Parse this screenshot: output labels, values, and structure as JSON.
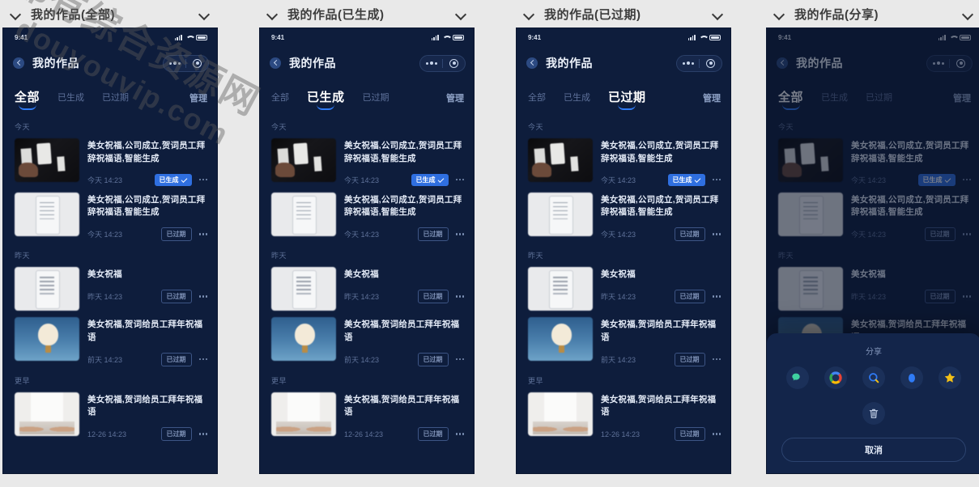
{
  "panels": [
    {
      "caption": "我的作品(全部)",
      "active_tab": 0,
      "shaded": false,
      "sheet": false
    },
    {
      "caption": "我的作品(已生成)",
      "active_tab": 1,
      "shaded": false,
      "sheet": false
    },
    {
      "caption": "我的作品(已过期)",
      "active_tab": 2,
      "shaded": false,
      "sheet": false
    },
    {
      "caption": "我的作品(分享)",
      "active_tab": 0,
      "shaded": true,
      "sheet": true
    }
  ],
  "statusbar": {
    "time": "9:41",
    "signal_icon": "signal-bars-icon",
    "wifi_icon": "wifi-icon",
    "battery_icon": "battery-icon"
  },
  "navbar": {
    "back_icon": "back-arrow-icon",
    "title": "我的作品",
    "capsule_more_icon": "more-dots-icon",
    "capsule_target_icon": "target-circle-icon"
  },
  "tabs": {
    "items": [
      "全部",
      "已生成",
      "已过期"
    ],
    "manage_label": "管理"
  },
  "groups": [
    {
      "label": "今天",
      "items": [
        {
          "title": "美女祝福,公司成立,贺词员工拜辞祝福语,智能生成",
          "time": "今天 14:23",
          "status": "已生成",
          "status_type": "done",
          "thumb": "playing-cards-thumbnail"
        },
        {
          "title": "美女祝福,公司成立,贺词员工拜辞祝福语,智能生成",
          "time": "今天 14:23",
          "status": "已过期",
          "status_type": "expired",
          "thumb": "document-thumbnail"
        }
      ]
    },
    {
      "label": "昨天",
      "items": [
        {
          "title": "美女祝福",
          "time": "昨天 14:23",
          "status": "已过期",
          "status_type": "expired",
          "thumb": "document-thumbnail"
        },
        {
          "title": "美女祝福,贺词给员工拜年祝福语",
          "time": "前天 14:23",
          "status": "已过期",
          "status_type": "expired",
          "thumb": "balloon-thumbnail"
        }
      ]
    },
    {
      "label": "更早",
      "items": [
        {
          "title": "美女祝福,贺词给员工拜年祝福语",
          "time": "12-26 14:23",
          "status": "已过期",
          "status_type": "expired",
          "thumb": "room-thumbnail"
        }
      ]
    }
  ],
  "share_sheet": {
    "title": "分享",
    "items": [
      {
        "name": "wechat-share-icon",
        "color": "#3fd0a0"
      },
      {
        "name": "multicolor-circle-share-icon",
        "color": "#e84c3d"
      },
      {
        "name": "qq-browser-share-icon",
        "color": "#2f7bf6"
      },
      {
        "name": "qq-share-icon",
        "color": "#2f7bf6"
      },
      {
        "name": "favorite-star-icon",
        "color": "#f3c017"
      }
    ],
    "delete_icon": "trash-icon",
    "cancel_label": "取消"
  },
  "watermark": {
    "line1": "都有综合资源网",
    "line2": "douyouvip.com"
  },
  "colors": {
    "bg": "#0e1d3c",
    "accent": "#2f7bf6",
    "badge_done": "#2f6fe0",
    "page_bg": "#e9e9e9"
  }
}
